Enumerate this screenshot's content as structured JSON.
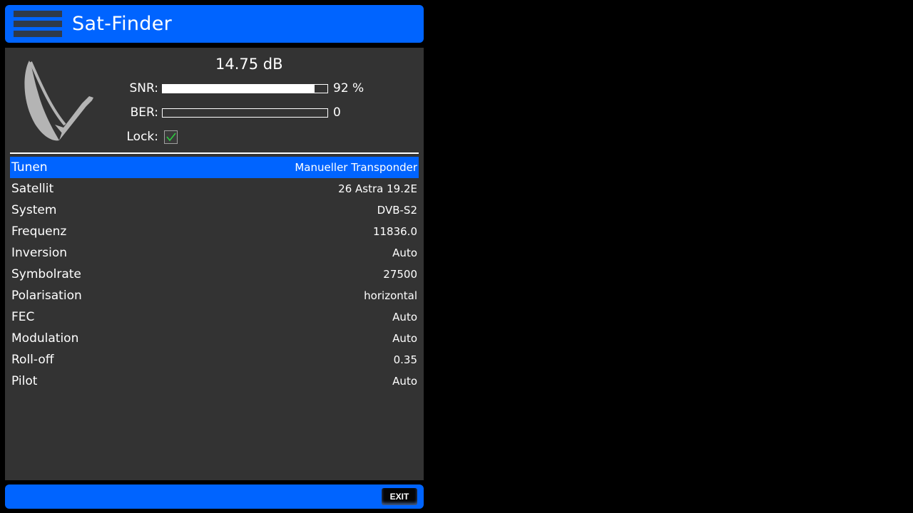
{
  "header": {
    "title": "Sat-Finder",
    "menu_icon": "hamburger-menu-icon"
  },
  "signal": {
    "icon": "satellite-dish-icon",
    "level": "14.75 dB",
    "snr_label": "SNR:",
    "snr_value": "92 %",
    "snr_fraction": 0.92,
    "ber_label": "BER:",
    "ber_value": "0",
    "ber_fraction": 0,
    "lock_label": "Lock:",
    "lock_checked": true
  },
  "colors": {
    "accent": "#0064ff",
    "panel": "#333333",
    "lock_check": "#2ecc40"
  },
  "settings": [
    {
      "label": "Tunen",
      "value": "Manueller Transponder",
      "selected": true
    },
    {
      "label": "Satellit",
      "value": "26 Astra 19.2E",
      "selected": false
    },
    {
      "label": "System",
      "value": "DVB-S2",
      "selected": false
    },
    {
      "label": "Frequenz",
      "value": "11836.0",
      "selected": false
    },
    {
      "label": "Inversion",
      "value": "Auto",
      "selected": false
    },
    {
      "label": "Symbolrate",
      "value": "27500",
      "selected": false
    },
    {
      "label": "Polarisation",
      "value": "horizontal",
      "selected": false
    },
    {
      "label": "FEC",
      "value": "Auto",
      "selected": false
    },
    {
      "label": "Modulation",
      "value": "Auto",
      "selected": false
    },
    {
      "label": "Roll-off",
      "value": "0.35",
      "selected": false
    },
    {
      "label": "Pilot",
      "value": "Auto",
      "selected": false
    }
  ],
  "footer": {
    "exit_label": "EXIT"
  }
}
